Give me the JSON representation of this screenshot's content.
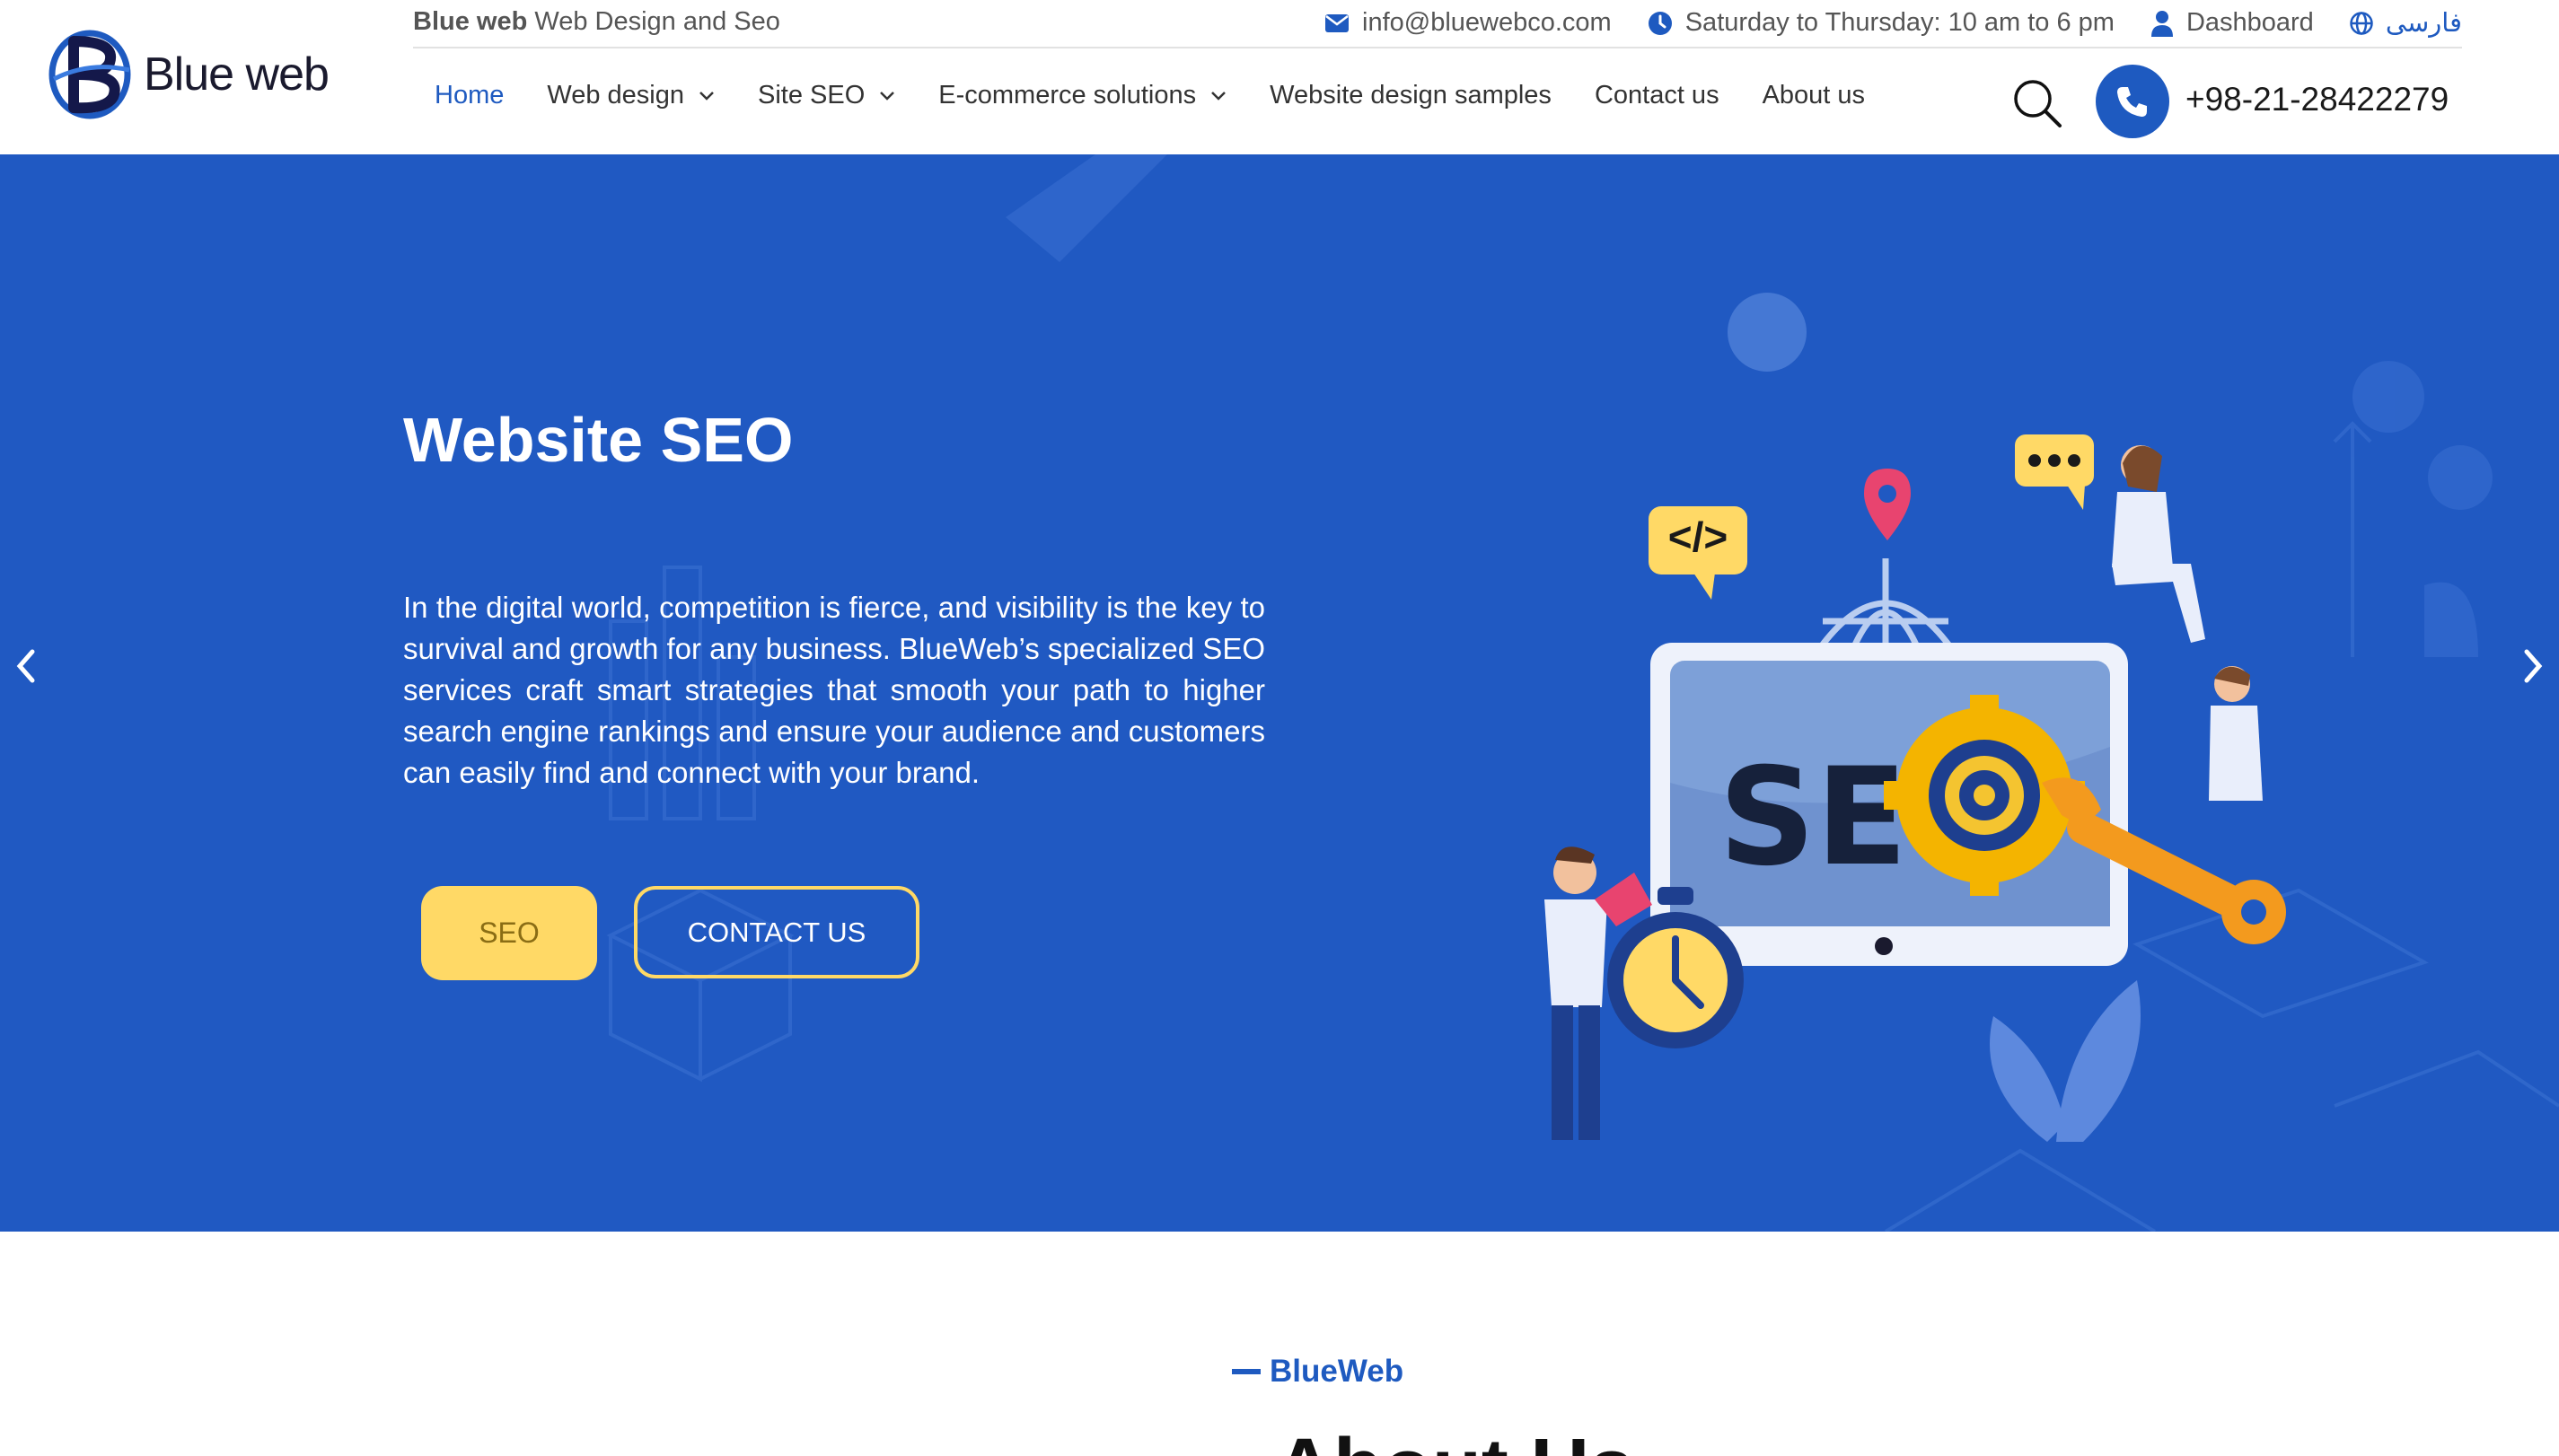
{
  "header": {
    "logo_text": "Blue web",
    "tagline_brand": "Blue web",
    "tagline_rest": " Web Design and Seo",
    "email": "info@bluewebco.com",
    "hours": "Saturday to Thursday: 10 am to 6 pm",
    "dashboard": "Dashboard",
    "language": "فارسی",
    "phone": "+98-21-28422279",
    "icons": [
      "envelope-icon",
      "clock-icon",
      "user-icon",
      "globe-icon",
      "search-icon",
      "phone-icon",
      "chevron-down-icon"
    ]
  },
  "nav": {
    "items": [
      {
        "label": "Home",
        "active": true
      },
      {
        "label": "Web design",
        "dropdown": true
      },
      {
        "label": "Site SEO",
        "dropdown": true
      },
      {
        "label": "E-commerce solutions",
        "dropdown": true
      },
      {
        "label": "Website design samples"
      },
      {
        "label": "Contact us"
      },
      {
        "label": "About us"
      }
    ]
  },
  "hero": {
    "title": "Website SEO",
    "text": "In the digital world, competition is fierce, and visibility is the key to survival and growth for any business. BlueWeb’s specialized SEO services craft smart strategies that smooth your path to higher search engine rankings and ensure your audience and customers can easily find and connect with your brand.",
    "btn_primary": "SEO",
    "btn_secondary": "CONTACT US",
    "illustration_text": "SE",
    "code_bubble": "</>",
    "colors": {
      "background": "#2059c2",
      "accent": "#ffd966"
    }
  },
  "about": {
    "label": "BlueWeb",
    "title": "About Us"
  }
}
